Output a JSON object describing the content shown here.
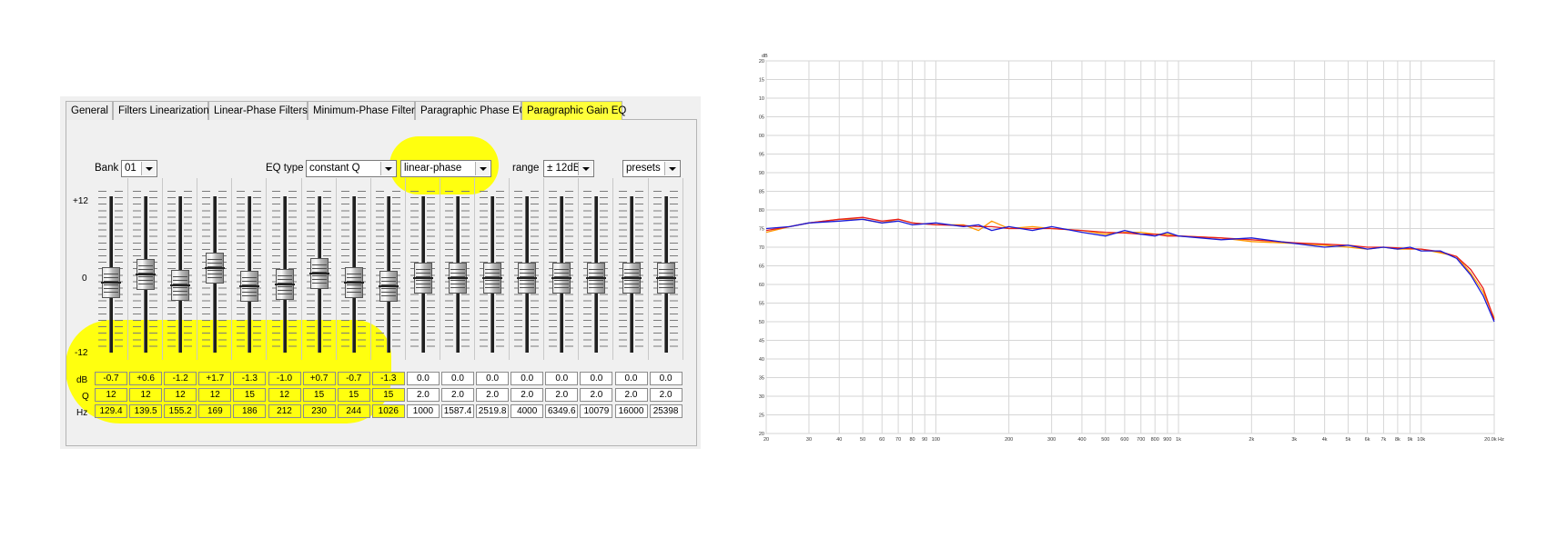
{
  "tabs": [
    "General",
    "Filters Linearization",
    "Linear-Phase Filters",
    "Minimum-Phase Filters",
    "Paragraphic Phase EQ",
    "Paragraphic Gain EQ"
  ],
  "active_tab": "Paragraphic Gain EQ",
  "controls": {
    "bank_label": "Bank",
    "bank_value": "01",
    "eqtype_label": "EQ type",
    "eqtype_value": "constant Q",
    "phase_value": "linear-phase",
    "range_label": "range",
    "range_value": "± 12dB",
    "presets_value": "presets"
  },
  "scale": {
    "top": "+12",
    "mid": "0",
    "bottom": "-12"
  },
  "row_labels": {
    "db": "dB",
    "q": "Q",
    "hz": "Hz"
  },
  "bands": [
    {
      "db": "-0.7",
      "q": "12",
      "hz": "129.4"
    },
    {
      "db": "+0.6",
      "q": "12",
      "hz": "139.5"
    },
    {
      "db": "-1.2",
      "q": "12",
      "hz": "155.2"
    },
    {
      "db": "+1.7",
      "q": "12",
      "hz": "169"
    },
    {
      "db": "-1.3",
      "q": "15",
      "hz": "186"
    },
    {
      "db": "-1.0",
      "q": "12",
      "hz": "212"
    },
    {
      "db": "+0.7",
      "q": "15",
      "hz": "230"
    },
    {
      "db": "-0.7",
      "q": "15",
      "hz": "244"
    },
    {
      "db": "-1.3",
      "q": "15",
      "hz": "1026"
    },
    {
      "db": "0.0",
      "q": "2.0",
      "hz": "1000"
    },
    {
      "db": "0.0",
      "q": "2.0",
      "hz": "1587.4"
    },
    {
      "db": "0.0",
      "q": "2.0",
      "hz": "2519.8"
    },
    {
      "db": "0.0",
      "q": "2.0",
      "hz": "4000"
    },
    {
      "db": "0.0",
      "q": "2.0",
      "hz": "6349.6"
    },
    {
      "db": "0.0",
      "q": "2.0",
      "hz": "10079"
    },
    {
      "db": "0.0",
      "q": "2.0",
      "hz": "16000"
    },
    {
      "db": "0.0",
      "q": "2.0",
      "hz": "25398"
    }
  ],
  "colors": {
    "highlight": "#ffff0f",
    "series_orange": "#ff9900",
    "series_red": "#e8201c",
    "series_blue": "#1a1ad8",
    "grid": "#d6d6d6"
  },
  "chart_data": {
    "type": "line",
    "xscale": "log",
    "xlim": [
      20,
      20000
    ],
    "ylim": [
      20,
      120
    ],
    "grid": true,
    "ylabel": "dB",
    "xunit": "Hz",
    "y_ticks": [
      "20",
      "25",
      "30",
      "35",
      "40",
      "45",
      "50",
      "55",
      "60",
      "65",
      "70",
      "75",
      "80",
      "85",
      "90",
      "95",
      "100",
      "105",
      "110",
      "115",
      "120"
    ],
    "x_ticks": [
      {
        "v": 20,
        "t": "20"
      },
      {
        "v": 30,
        "t": "30"
      },
      {
        "v": 40,
        "t": "40"
      },
      {
        "v": 50,
        "t": "50"
      },
      {
        "v": 60,
        "t": "60"
      },
      {
        "v": 70,
        "t": "70"
      },
      {
        "v": 80,
        "t": "80"
      },
      {
        "v": 90,
        "t": "90"
      },
      {
        "v": 100,
        "t": "100"
      },
      {
        "v": 200,
        "t": "200"
      },
      {
        "v": 300,
        "t": "300"
      },
      {
        "v": 400,
        "t": "400"
      },
      {
        "v": 500,
        "t": "500"
      },
      {
        "v": 600,
        "t": "600"
      },
      {
        "v": 700,
        "t": "700"
      },
      {
        "v": 800,
        "t": "800"
      },
      {
        "v": 900,
        "t": "900"
      },
      {
        "v": 1000,
        "t": "1k"
      },
      {
        "v": 2000,
        "t": "2k"
      },
      {
        "v": 3000,
        "t": "3k"
      },
      {
        "v": 4000,
        "t": "4k"
      },
      {
        "v": 5000,
        "t": "5k"
      },
      {
        "v": 6000,
        "t": "6k"
      },
      {
        "v": 7000,
        "t": "7k"
      },
      {
        "v": 8000,
        "t": "8k"
      },
      {
        "v": 9000,
        "t": "9k"
      },
      {
        "v": 10000,
        "t": "10k"
      },
      {
        "v": 20000,
        "t": "20.0k Hz"
      }
    ],
    "series": [
      {
        "color": "#ff9900",
        "x": [
          20,
          25,
          30,
          40,
          50,
          60,
          70,
          80,
          100,
          130,
          150,
          170,
          200,
          250,
          300,
          400,
          500,
          600,
          700,
          800,
          900,
          1000,
          1500,
          2000,
          3000,
          4000,
          5000,
          6000,
          7000,
          8000,
          9000,
          10000,
          12000,
          14000,
          16000,
          18000,
          20000
        ],
        "y": [
          74,
          75.5,
          76.5,
          77.5,
          77.5,
          76.5,
          77.5,
          76.5,
          76,
          76,
          74.5,
          77,
          75,
          75.5,
          75,
          74.5,
          73.5,
          74,
          74,
          73.5,
          73.5,
          73,
          72.5,
          71.5,
          71,
          70.5,
          70,
          69.5,
          70,
          69.5,
          69.5,
          69.5,
          68.5,
          67.5,
          63,
          58,
          51
        ]
      },
      {
        "color": "#e8201c",
        "x": [
          20,
          25,
          30,
          40,
          50,
          60,
          70,
          80,
          100,
          130,
          150,
          170,
          200,
          250,
          300,
          400,
          500,
          600,
          700,
          800,
          900,
          1000,
          1500,
          2000,
          3000,
          4000,
          5000,
          6000,
          7000,
          8000,
          9000,
          10000,
          12000,
          14000,
          16000,
          18000,
          20000
        ],
        "y": [
          74.5,
          75.5,
          76.5,
          77.5,
          78,
          77,
          77.5,
          76.5,
          76,
          75.8,
          75.5,
          75.5,
          75,
          75,
          75,
          74.5,
          74,
          73.8,
          73.5,
          73.5,
          73,
          73,
          72.5,
          72,
          71.2,
          70.8,
          70.5,
          70,
          70,
          69.8,
          69.6,
          69.5,
          68.8,
          67.5,
          64,
          59,
          50.5
        ]
      },
      {
        "color": "#1a1ad8",
        "x": [
          20,
          25,
          30,
          40,
          50,
          60,
          70,
          80,
          100,
          130,
          150,
          170,
          200,
          250,
          300,
          400,
          500,
          600,
          700,
          800,
          900,
          1000,
          1500,
          2000,
          3000,
          4000,
          5000,
          6000,
          7000,
          8000,
          9000,
          10000,
          12000,
          14000,
          16000,
          18000,
          20000
        ],
        "y": [
          75,
          75.5,
          76.5,
          77,
          77.5,
          76.5,
          77,
          76,
          76.5,
          75.5,
          76,
          74.5,
          75.5,
          74.5,
          75.5,
          74,
          73,
          74.5,
          73.5,
          73,
          74,
          73,
          72,
          72.5,
          71,
          70,
          70.5,
          69.5,
          70,
          69.5,
          70,
          69,
          69,
          67,
          62.5,
          57,
          50
        ]
      }
    ]
  }
}
